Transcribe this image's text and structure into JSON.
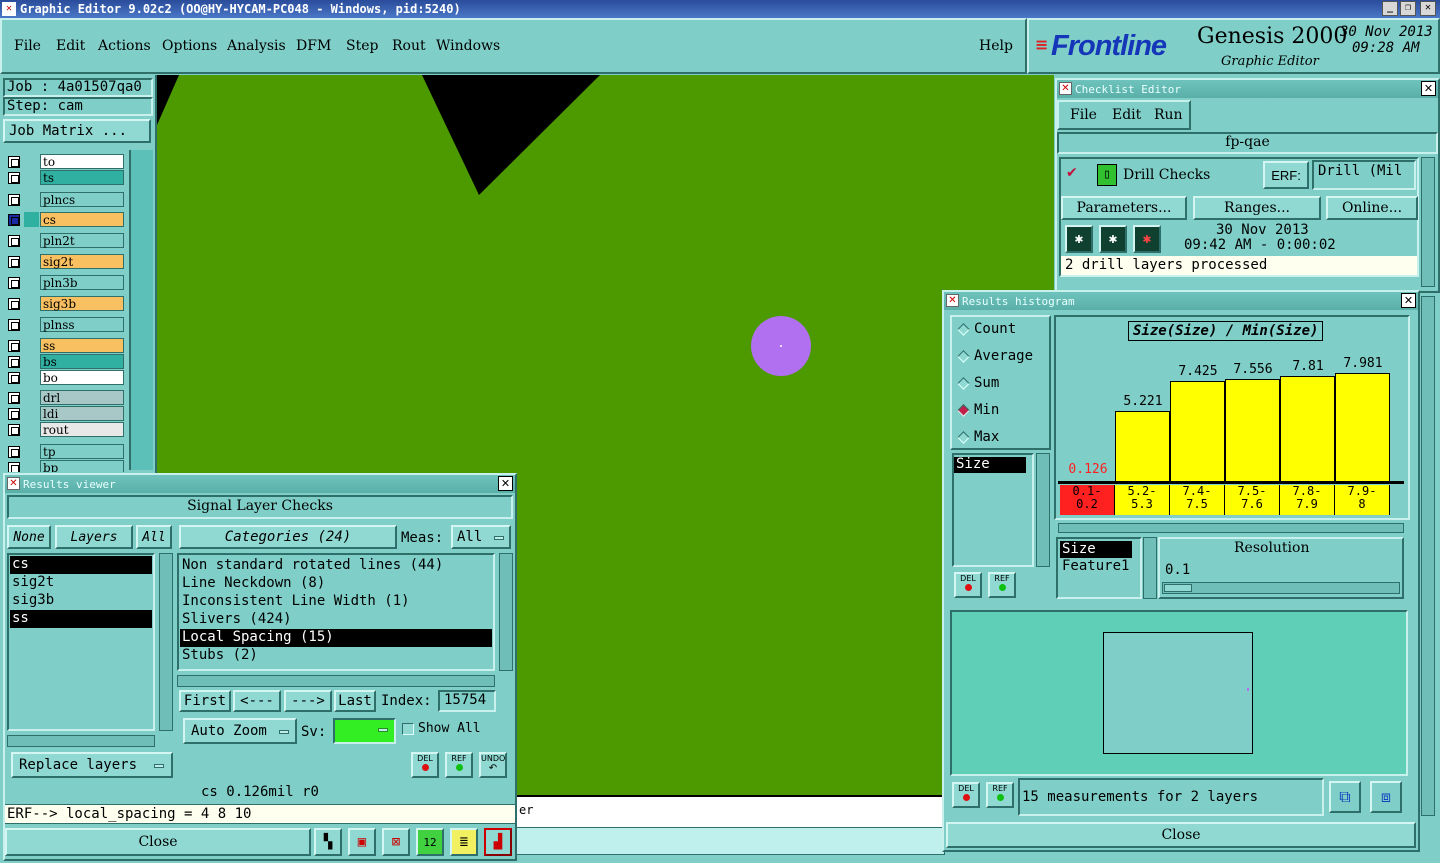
{
  "app": {
    "title": "Graphic Editor 9.02c2 (OO@HY-HYCAM-PC048 - Windows, pid:5240)"
  },
  "menu": [
    "File",
    "Edit",
    "Actions",
    "Options",
    "Analysis",
    "DFM",
    "Step",
    "Rout",
    "Windows"
  ],
  "help": "Help",
  "brand": {
    "logo": "Frontline",
    "product": "Genesis 2000",
    "subtitle": "Graphic Editor",
    "date": "30 Nov 2013",
    "time": "09:28 AM"
  },
  "job": {
    "job": "Job : 4a01507qa0",
    "step": "Step: cam",
    "matrix_btn": "Job Matrix ..."
  },
  "layers": [
    "to",
    "ts",
    "plncs",
    "cs",
    "pln2t",
    "sig2t",
    "pln3b",
    "sig3b",
    "plnss",
    "ss",
    "bs",
    "bo",
    "drl",
    "ldi",
    "rout",
    "tp",
    "bp"
  ],
  "canvas": {
    "colors": {
      "board": "#4c9a00",
      "void": "#000000",
      "pad": "#b070f0"
    }
  },
  "results_viewer": {
    "title": "Results viewer",
    "section": "Signal Layer Checks",
    "none": "None",
    "layers_lbl": "Layers",
    "all": "All",
    "categories_lbl": "Categories (24)",
    "meas_lbl": "Meas:",
    "meas_val": "All",
    "layer_list": [
      "cs",
      "sig2t",
      "sig3b",
      "ss"
    ],
    "categories": [
      "Non standard rotated lines (44)",
      "Line Neckdown (8)",
      "Inconsistent Line Width (1)",
      "Slivers (424)",
      "Local Spacing (15)",
      "Stubs (2)"
    ],
    "nav": {
      "first": "First",
      "prev": "<---",
      "next": "--->",
      "last": "Last",
      "index_lbl": "Index:",
      "index_val": "15754"
    },
    "auto_zoom": "Auto Zoom",
    "sv_lbl": "Sv:",
    "show_all": "Show All",
    "replace": "Replace layers",
    "btn_del": "DEL",
    "btn_ref": "REF",
    "btn_undo": "UNDO",
    "status": "cs 0.126mil  r0",
    "erf": "ERF--> local_spacing = 4 8 10",
    "close": "Close",
    "bottom_strip": "er"
  },
  "checklist": {
    "title": "Checklist Editor",
    "menu": [
      "File",
      "Edit",
      "Run"
    ],
    "name": "fp-qae",
    "check": "Drill Checks",
    "erf_lbl": "ERF:",
    "erf_val": "Drill (Mil",
    "params": "Parameters...",
    "ranges": "Ranges...",
    "online": "Online...",
    "date": "30 Nov 2013",
    "time": "09:42 AM - 0:00:02",
    "status": "2 drill layers processed"
  },
  "histogram": {
    "title": "Results histogram",
    "modes": [
      "Count",
      "Average",
      "Sum",
      "Min",
      "Max"
    ],
    "selected_mode": "Min",
    "chart_title": "Size(Size) / Min(Size)",
    "attr_list": [
      "Size"
    ],
    "list2": [
      "Size",
      "Feature1"
    ],
    "resolution_lbl": "Resolution",
    "resolution_val": "0.1",
    "summary": "15 measurements for 2 layers",
    "close": "Close",
    "btn_del": "DEL",
    "btn_ref": "REF"
  },
  "chart_data": {
    "type": "bar",
    "title": "Size(Size) / Min(Size)",
    "categories": [
      "0.1-0.2",
      "5.2-5.3",
      "7.4-7.5",
      "7.5-7.6",
      "7.8-7.9",
      "7.9-8"
    ],
    "category_labels": [
      [
        "0.1-",
        "0.2"
      ],
      [
        "5.2-",
        "5.3"
      ],
      [
        "7.4-",
        "7.5"
      ],
      [
        "7.5-",
        "7.6"
      ],
      [
        "7.8-",
        "7.9"
      ],
      [
        "7.9-",
        "8"
      ]
    ],
    "values": [
      0.126,
      5.221,
      7.425,
      7.556,
      7.81,
      7.981
    ],
    "value_labels": [
      "0.126",
      "5.221",
      "7.425",
      "7.556",
      "7.81",
      "7.981"
    ],
    "ylim": [
      0,
      8
    ],
    "colors": {
      "bar": "#ffff00",
      "highlight": "#ff2020"
    }
  }
}
